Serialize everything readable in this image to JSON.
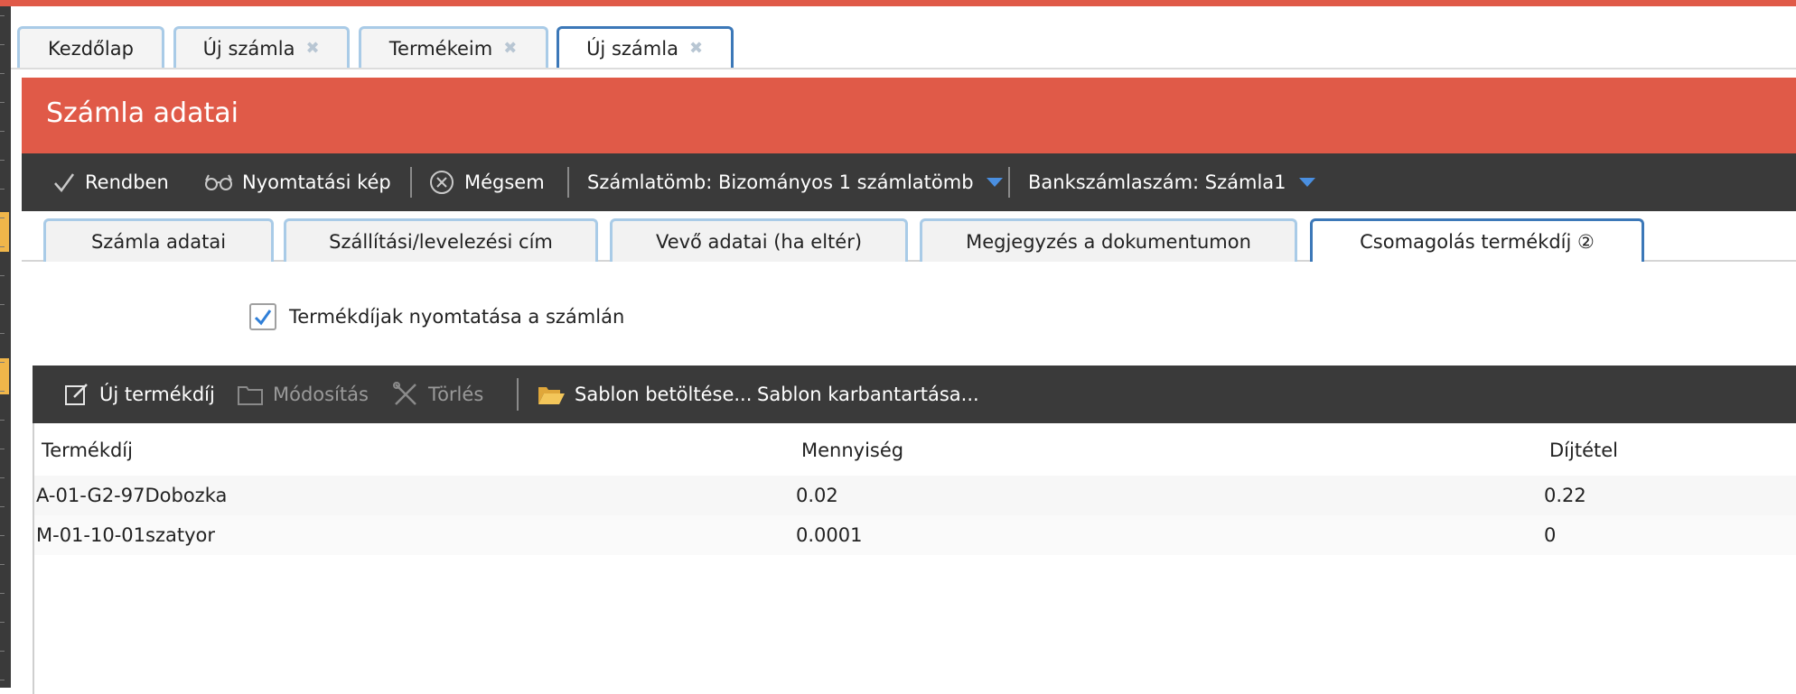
{
  "top_tabs": [
    {
      "label": "Kezdőlap",
      "closable": false,
      "active": false
    },
    {
      "label": "Új számla",
      "closable": true,
      "active": false
    },
    {
      "label": "Termékeim",
      "closable": true,
      "active": false
    },
    {
      "label": "Új számla",
      "closable": true,
      "active": true
    }
  ],
  "panel": {
    "title": "Számla adatai"
  },
  "toolbar": {
    "ok_label": "Rendben",
    "print_preview_label": "Nyomtatási kép",
    "cancel_label": "Mégsem",
    "invoice_block_label": "Számlatömb: Bizományos 1 számlatömb",
    "bank_account_label": "Bankszámlaszám: Számla1"
  },
  "inner_tabs": [
    {
      "label": "Számla adatai",
      "active": false
    },
    {
      "label": "Szállítási/levelezési cím",
      "active": false
    },
    {
      "label": "Vevő adatai (ha eltér)",
      "active": false
    },
    {
      "label": "Megjegyzés a dokumentumon",
      "active": false
    },
    {
      "label": "Csomagolás termékdíj ②",
      "active": true
    }
  ],
  "print_fees": {
    "label": "Termékdíjak nyomtatása a számlán",
    "checked": true
  },
  "grid_toolbar": {
    "new_label": "Új termékdíj",
    "edit_label": "Módosítás",
    "delete_label": "Törlés",
    "load_template_label": "Sablon betöltése...",
    "manage_template_label": "Sablon karbantartása..."
  },
  "table": {
    "columns": [
      "Termékdíj",
      "Mennyiség",
      "Díjtétel"
    ],
    "rows": [
      [
        "A-01-G2-97Dobozka",
        "0.02",
        "0.22"
      ],
      [
        "M-01-10-01szatyor",
        "0.0001",
        "0"
      ]
    ]
  },
  "colors": {
    "accent": "#e05a48",
    "toolbar": "#3a3a3a",
    "tab_border": "#a9cbe7",
    "active_tab_border": "#3c78b8",
    "caret": "#4a8fe0"
  }
}
